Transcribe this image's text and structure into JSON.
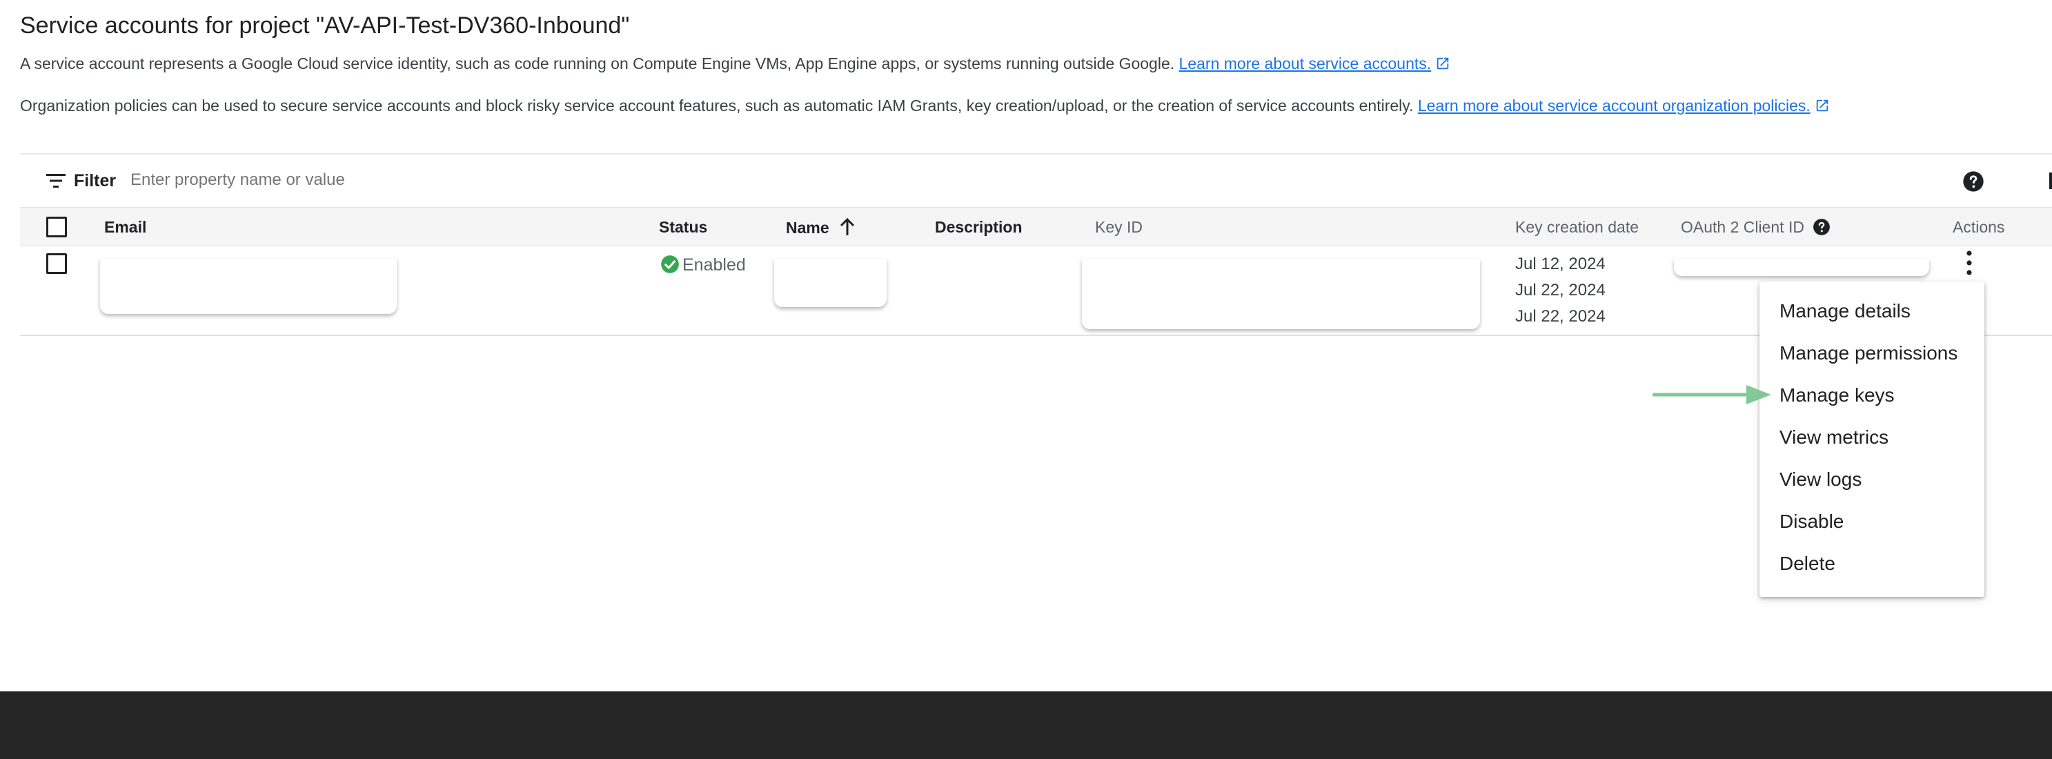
{
  "page": {
    "title": "Service accounts for project \"AV-API-Test-DV360-Inbound\"",
    "description1": "A service account represents a Google Cloud service identity, such as code running on Compute Engine VMs, App Engine apps, or systems running outside Google.",
    "description1_link": "Learn more about service accounts.",
    "description2": "Organization policies can be used to secure service accounts and block risky service account features, such as automatic IAM Grants, key creation/upload, or the creation of service accounts entirely.",
    "description2_link": "Learn more about service account organization policies.",
    "link_color": "#1a73e8"
  },
  "filter": {
    "label": "Filter",
    "placeholder": "Enter property name or value",
    "icons": [
      "filter-icon",
      "help-icon",
      "columns-icon"
    ]
  },
  "table": {
    "columns": [
      "Email",
      "Status",
      "Name",
      "Description",
      "Key ID",
      "Key creation date",
      "OAuth 2 Client ID",
      "Actions"
    ],
    "sort_column": "Name",
    "sort_direction": "ascending",
    "rows": [
      {
        "status": "Enabled",
        "status_color": "#34a853",
        "key_creation_dates": [
          "Jul 12, 2024",
          "Jul 22, 2024",
          "Jul 22, 2024"
        ]
      }
    ]
  },
  "actions_menu": {
    "items": [
      "Manage details",
      "Manage permissions",
      "Manage keys",
      "View metrics",
      "View logs",
      "Disable",
      "Delete"
    ],
    "highlighted": "Manage keys",
    "arrow_color": "#81c995"
  }
}
